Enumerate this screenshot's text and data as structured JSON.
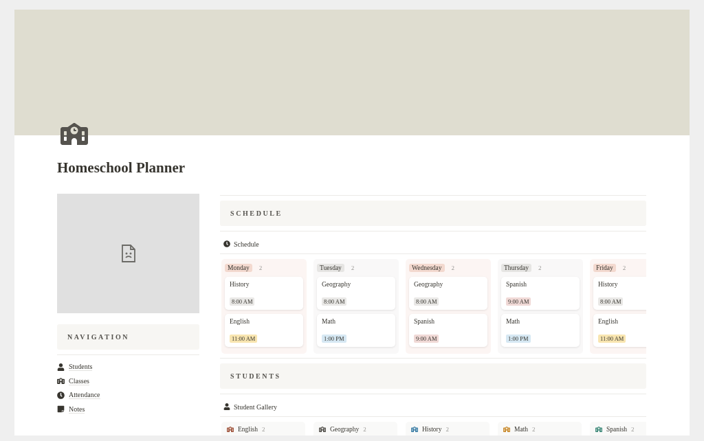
{
  "title": "Homeschool Planner",
  "navigation": {
    "heading": "NAVIGATION",
    "items": [
      {
        "label": "Students"
      },
      {
        "label": "Classes"
      },
      {
        "label": "Attendance"
      },
      {
        "label": "Notes"
      }
    ]
  },
  "schedule": {
    "heading": "SCHEDULE",
    "view": "Schedule",
    "columns": [
      {
        "day": "Monday",
        "count": "2",
        "color": "#f3d9cf",
        "items": [
          {
            "subject": "History",
            "time": "8:00 AM",
            "color": "#e9e8e6"
          },
          {
            "subject": "English",
            "time": "11:00 AM",
            "color": "#f8e5b0"
          }
        ]
      },
      {
        "day": "Tuesday",
        "count": "2",
        "color": "#e6e5e3",
        "items": [
          {
            "subject": "Geography",
            "time": "8:00 AM",
            "color": "#e9e8e6"
          },
          {
            "subject": "Math",
            "time": "1:00 PM",
            "color": "#d6e8f3"
          }
        ]
      },
      {
        "day": "Wednesday",
        "count": "2",
        "color": "#f3d9cf",
        "items": [
          {
            "subject": "Geography",
            "time": "8:00 AM",
            "color": "#e9e8e6"
          },
          {
            "subject": "Spanish",
            "time": "9:00 AM",
            "color": "#f0d9d6"
          }
        ]
      },
      {
        "day": "Thursday",
        "count": "2",
        "color": "#e6e5e3",
        "items": [
          {
            "subject": "Spanish",
            "time": "9:00 AM",
            "color": "#f0d9d6"
          },
          {
            "subject": "Math",
            "time": "1:00 PM",
            "color": "#d6e8f3"
          }
        ]
      },
      {
        "day": "Friday",
        "count": "2",
        "color": "#f3d9cf",
        "items": [
          {
            "subject": "History",
            "time": "8:00 AM",
            "color": "#e9e8e6"
          },
          {
            "subject": "English",
            "time": "11:00 AM",
            "color": "#f8e5b0"
          }
        ]
      }
    ]
  },
  "students": {
    "heading": "STUDENTS",
    "view": "Student Gallery",
    "groups": [
      {
        "label": "English",
        "count": "2",
        "color": "#a0543c"
      },
      {
        "label": "Geography",
        "count": "2",
        "color": "#55534e"
      },
      {
        "label": "History",
        "count": "2",
        "color": "#3d7fa6"
      },
      {
        "label": "Math",
        "count": "2",
        "color": "#c98a2b"
      },
      {
        "label": "Spanish",
        "count": "2",
        "color": "#3f8a7a"
      }
    ]
  }
}
